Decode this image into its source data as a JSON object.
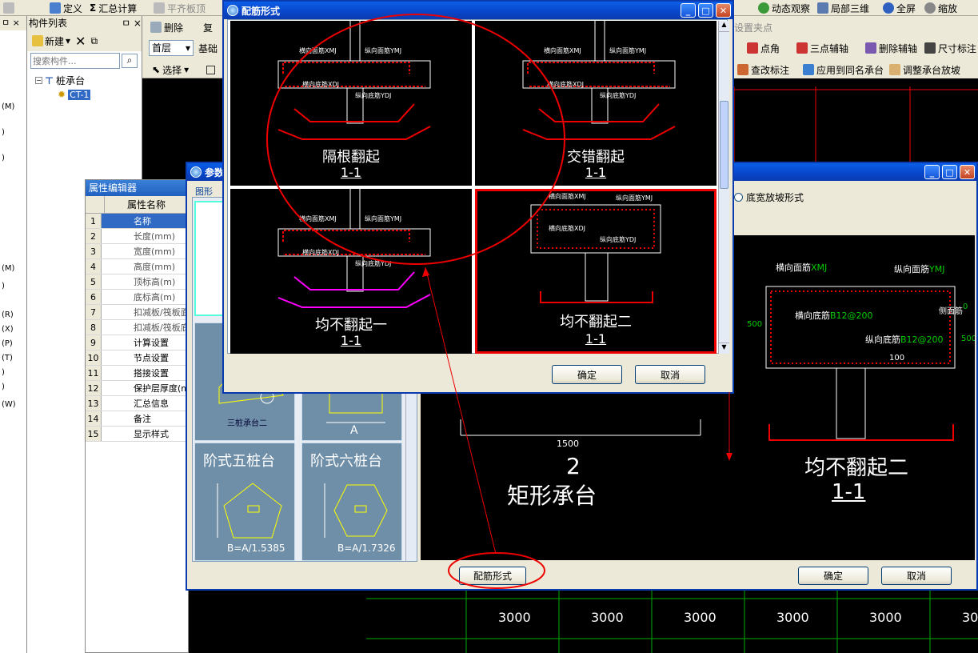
{
  "toolbar_top": {
    "define": "定义",
    "summary": "汇总计算",
    "flat_top": "平齐板顶",
    "dynamic_view": "动态观察",
    "local_3d": "局部三维",
    "fullscreen": "全屏",
    "zoom": "缩放"
  },
  "toolbar_right": {
    "set_clip": "设置夹点",
    "point_angle": "点角",
    "three_point_axis": "三点辅轴",
    "delete_axis": "删除辅轴",
    "dim_label": "尺寸标注",
    "modify_label": "查改标注",
    "apply_same": "应用到同名承台",
    "adjust_slope": "调整承台放坡"
  },
  "component_list": {
    "title": "构件列表",
    "new_button": "新建",
    "search_placeholder": "搜索构件...",
    "tree_root": "桩承台",
    "tree_child": "CT-1"
  },
  "toolbar_row2": {
    "delete": "删除",
    "copy": "复",
    "floor_value": "首层",
    "base_value": "基础",
    "select": "选择"
  },
  "left_strip_letters": [
    "(M)",
    ")",
    ")",
    "(M)",
    ")",
    "(R)",
    "(X)",
    "(P)",
    "(T)",
    ")",
    ")",
    "(W)"
  ],
  "property_editor": {
    "title": "属性编辑器",
    "header": "属性名称",
    "rows": [
      {
        "num": "1",
        "name": "名称"
      },
      {
        "num": "2",
        "name": "长度(mm)"
      },
      {
        "num": "3",
        "name": "宽度(mm)"
      },
      {
        "num": "4",
        "name": "高度(mm)"
      },
      {
        "num": "5",
        "name": "顶标高(m)"
      },
      {
        "num": "6",
        "name": "底标高(m)"
      },
      {
        "num": "7",
        "name": "扣减板/筏板面"
      },
      {
        "num": "8",
        "name": "扣减板/筏板底"
      },
      {
        "num": "9",
        "name": "计算设置"
      },
      {
        "num": "10",
        "name": "节点设置"
      },
      {
        "num": "11",
        "name": "搭接设置"
      },
      {
        "num": "12",
        "name": "保护层厚度(mm"
      },
      {
        "num": "13",
        "name": "汇总信息"
      },
      {
        "num": "14",
        "name": "备注"
      },
      {
        "num": "15",
        "name": "显示样式"
      }
    ]
  },
  "param_dialog": {
    "title": "参数",
    "tab_label": "图形",
    "radio_label": "底宽放坡形式",
    "cards": [
      {
        "title": "三桩承台二",
        "formula": ""
      },
      {
        "title": "",
        "formula": "A"
      },
      {
        "title": "阶式五桩台",
        "formula": "B=A/1.5385"
      },
      {
        "title": "阶式六桩台",
        "formula": "B=A/1.7326"
      }
    ],
    "preview": {
      "top_rebar_h": "横向面筋",
      "top_rebar_h_code": "XMJ",
      "top_rebar_v": "纵向面筋",
      "top_rebar_v_code": "YMJ",
      "bottom_rebar_h": "横向底筋",
      "bottom_rebar_h_val": "B12@200",
      "bottom_rebar_v": "纵向底筋",
      "bottom_rebar_v_val": "B12@200",
      "side_rebar": "侧面筋",
      "dim_500a": "500",
      "dim_500b": "500",
      "dim_0": "0",
      "dim_100": "100",
      "caption": "均不翻起二",
      "section": "1-1"
    },
    "left_preview": {
      "dim_1500": "1500",
      "num": "2",
      "caption": "矩形承台"
    },
    "rebar_button": "配筋形式",
    "ok": "确定",
    "cancel": "取消"
  },
  "rebar_dialog": {
    "title": "配筋形式",
    "options": [
      {
        "caption": "隔根翻起",
        "section": "1-1"
      },
      {
        "caption": "交错翻起",
        "section": "1-1"
      },
      {
        "caption": "均不翻起一",
        "section": "1-1"
      },
      {
        "caption": "均不翻起二",
        "section": "1-1"
      }
    ],
    "labels": {
      "xmj": "横向面筋XMJ",
      "ymj": "纵向面筋YMJ",
      "xdj": "横向底筋XDJ",
      "ydj": "纵向底筋YDJ"
    },
    "ok": "确定",
    "cancel": "取消"
  },
  "grid_dims": [
    "3000",
    "3000",
    "3000",
    "3000",
    "3000",
    "30"
  ],
  "colors": {
    "titlebar": "#0a4ad8",
    "annotation": "#e00000",
    "cad_bg": "#000000",
    "cad_green": "#00c800"
  }
}
